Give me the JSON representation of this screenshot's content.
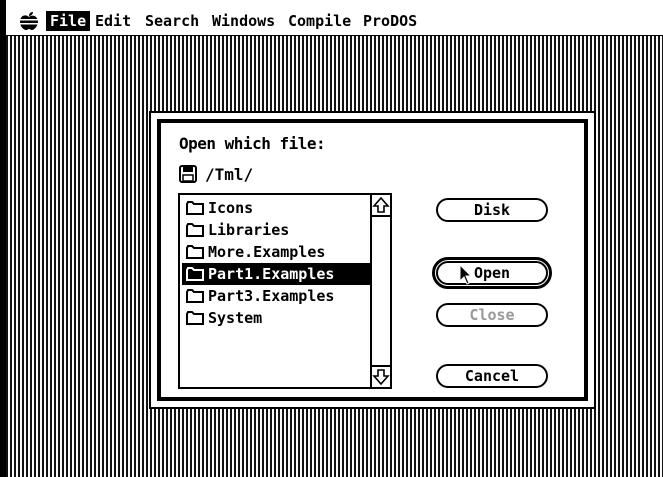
{
  "menubar": {
    "apple_icon": "apple-icon",
    "items": [
      "File",
      "Edit",
      "Search",
      "Windows",
      "Compile",
      "ProDOS"
    ],
    "active": "File"
  },
  "dialog": {
    "title": "Open which file:",
    "volume_icon": "floppy-disk-icon",
    "volume": "/Tml/",
    "files": [
      {
        "name": "Icons",
        "icon": "folder-icon",
        "selected": false
      },
      {
        "name": "Libraries",
        "icon": "folder-icon",
        "selected": false
      },
      {
        "name": "More.Examples",
        "icon": "folder-icon",
        "selected": false
      },
      {
        "name": "Part1.Examples",
        "icon": "folder-icon",
        "selected": true
      },
      {
        "name": "Part3.Examples",
        "icon": "folder-icon",
        "selected": false
      },
      {
        "name": "System",
        "icon": "folder-icon",
        "selected": false
      }
    ],
    "buttons": {
      "disk": "Disk",
      "open": "Open",
      "close": "Close",
      "cancel": "Cancel"
    }
  }
}
